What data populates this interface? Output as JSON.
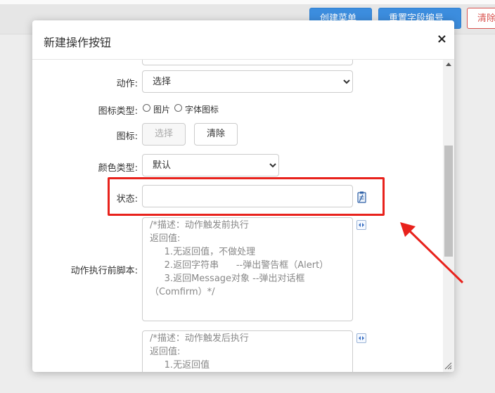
{
  "toolbar": {
    "create_menu_label": "创建菜单",
    "reset_field_label": "重置字段编号",
    "clear_label": "清除"
  },
  "dialog": {
    "title": "新建操作按钮",
    "close_symbol": "×"
  },
  "form": {
    "action_label": "动作:",
    "action_value": "选择",
    "icon_type_label": "图标类型:",
    "icon_type_options": [
      "图片",
      "字体图标"
    ],
    "icon_label": "图标:",
    "icon_select_button": "选择",
    "icon_clear_button": "清除",
    "color_type_label": "颜色类型:",
    "color_type_value": "默认",
    "status_label": "状态:",
    "status_value": "",
    "before_script_label": "动作执行前脚本:",
    "before_script_text": "/*描述：动作触发前执行\n返回值:\n     1.无返回值，不做处理\n     2.返回字符串      --弹出警告框（Alert）\n     3.返回Message对象 --弹出对话框\n（Comfirm）*/",
    "after_script_text": "/*描述：动作触发后执行\n返回值:\n     1.无返回值"
  },
  "colors": {
    "highlight": "#e8221c",
    "primary": "#3c8dde",
    "danger": "#d9534f"
  }
}
